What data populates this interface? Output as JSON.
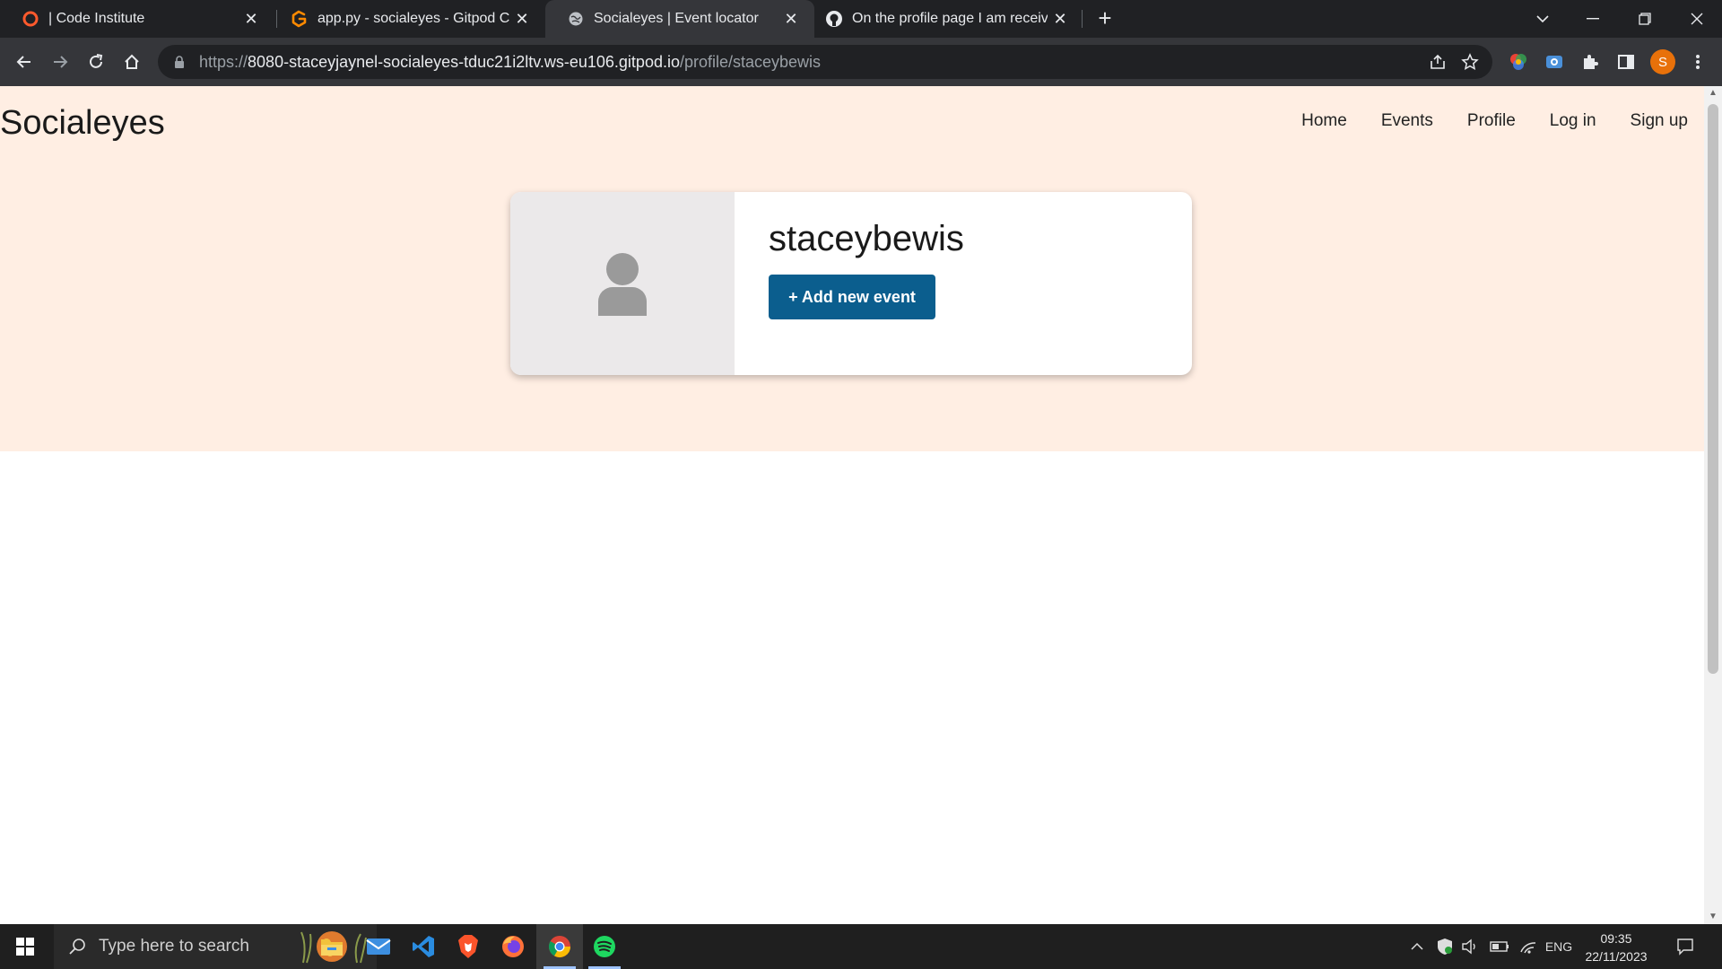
{
  "browser": {
    "tabs": [
      {
        "title": "| Code Institute",
        "icon": "code-institute-icon",
        "active": false
      },
      {
        "title": "app.py - socialeyes - Gitpod Cod",
        "icon": "gitpod-icon",
        "active": false
      },
      {
        "title": "Socialeyes | Event locator",
        "icon": "globe-icon",
        "active": true
      },
      {
        "title": "On the profile page I am receivin",
        "icon": "github-icon",
        "active": false
      }
    ],
    "url_prefix": "https://",
    "url_host": "8080-staceyjaynel-socialeyes-tduc21i2ltv.ws-eu106.gitpod.io",
    "url_path": "/profile/staceybewis",
    "profile_initial": "S"
  },
  "site": {
    "brand": "Socialeyes",
    "nav": [
      "Home",
      "Events",
      "Profile",
      "Log in",
      "Sign up"
    ]
  },
  "profile": {
    "username": "staceybewis",
    "add_event_label": "+ Add new event"
  },
  "taskbar": {
    "search_placeholder": "Type here to search",
    "apps": [
      "file-explorer-icon",
      "mail-icon",
      "vscode-icon",
      "brave-icon",
      "firefox-icon",
      "chrome-icon",
      "spotify-icon"
    ],
    "language": "ENG",
    "time": "09:35",
    "date": "22/11/2023"
  },
  "colors": {
    "hero_bg": "#ffeee3",
    "button": "#0b5e8e",
    "tab_strip": "#202124",
    "toolbar": "#35363a"
  }
}
